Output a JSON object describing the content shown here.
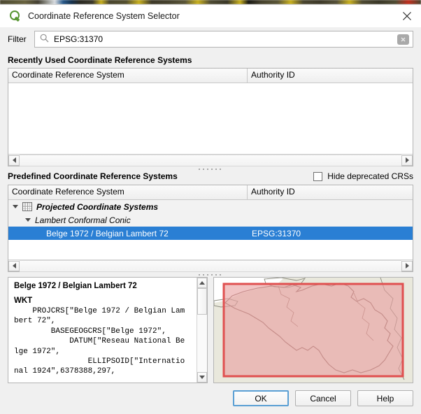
{
  "window": {
    "title": "Coordinate Reference System Selector",
    "app_icon": "qgis-logo-icon",
    "close_icon": "close-icon"
  },
  "filter": {
    "label": "Filter",
    "value": "EPSG:31370",
    "placeholder": "",
    "search_icon": "search-icon",
    "clear_icon": "clear-icon"
  },
  "recently_used": {
    "title": "Recently Used Coordinate Reference Systems",
    "columns": [
      "Coordinate Reference System",
      "Authority ID"
    ],
    "rows": []
  },
  "predefined": {
    "title": "Predefined Coordinate Reference Systems",
    "hide_deprecated": {
      "label": "Hide deprecated CRSs",
      "checked": false
    },
    "columns": [
      "Coordinate Reference System",
      "Authority ID"
    ],
    "rows": [
      {
        "level": 0,
        "label": "Projected Coordinate Systems",
        "authority": "",
        "expanded": true,
        "icon": "grid-icon",
        "selected": false
      },
      {
        "level": 1,
        "label": "Lambert Conformal Conic",
        "authority": "",
        "expanded": true,
        "icon": "",
        "selected": false
      },
      {
        "level": 2,
        "label": "Belge 1972 / Belgian Lambert 72",
        "authority": "EPSG:31370",
        "expanded": false,
        "icon": "",
        "selected": true
      }
    ]
  },
  "details": {
    "crs_name": "Belge 1972 / Belgian Lambert 72",
    "wkt_label": "WKT",
    "wkt_text": "    PROJCRS[\"Belge 1972 / Belgian Lam\nbert 72\",\n        BASEGEOGCRS[\"Belge 1972\",\n            DATUM[\"Reseau National Be\nlge 1972\",\n                ELLIPSOID[\"Internatio\nnal 1924\",6378388,297,"
  },
  "map_preview": {
    "name": "crs-extent-preview",
    "extent_color": "#e8a0a0",
    "extent_border_color": "#e05050",
    "land_color": "#e9e8dc",
    "sea_color": "#ffffff"
  },
  "buttons": {
    "ok": "OK",
    "cancel": "Cancel",
    "help": "Help"
  }
}
